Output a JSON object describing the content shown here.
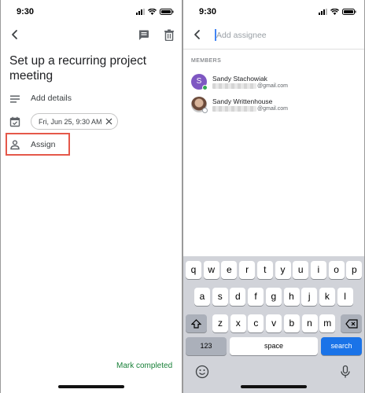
{
  "left": {
    "status_time": "9:30",
    "task_title": "Set up a recurring project meeting",
    "add_details_label": "Add details",
    "date_chip_label": "Fri, Jun 25, 9:30 AM",
    "assign_label": "Assign",
    "mark_completed_label": "Mark completed",
    "highlight_color": "#e5584a"
  },
  "right": {
    "status_time": "9:30",
    "assignee_placeholder": "Add assignee",
    "members_heading": "MEMBERS",
    "members": [
      {
        "avatar_letter": "S",
        "name": "Sandy Stachowiak",
        "email_suffix": "@gmail.com",
        "avatar_color": "#7e57c2",
        "online": true
      },
      {
        "avatar_letter": "",
        "name": "Sandy Writtenhouse",
        "email_suffix": "@gmail.com",
        "online": false
      }
    ]
  },
  "keyboard": {
    "row1": [
      "q",
      "w",
      "e",
      "r",
      "t",
      "y",
      "u",
      "i",
      "o",
      "p"
    ],
    "row2": [
      "a",
      "s",
      "d",
      "f",
      "g",
      "h",
      "j",
      "k",
      "l"
    ],
    "row3": [
      "z",
      "x",
      "c",
      "v",
      "b",
      "n",
      "m"
    ],
    "numbers_label": "123",
    "space_label": "space",
    "search_label": "search",
    "search_color": "#1a73e8",
    "icons": [
      "shift-icon",
      "backspace-icon",
      "emoji-icon",
      "microphone-icon"
    ]
  },
  "colors": {
    "accent_green": "#188038",
    "cursor_blue": "#4285f4"
  }
}
